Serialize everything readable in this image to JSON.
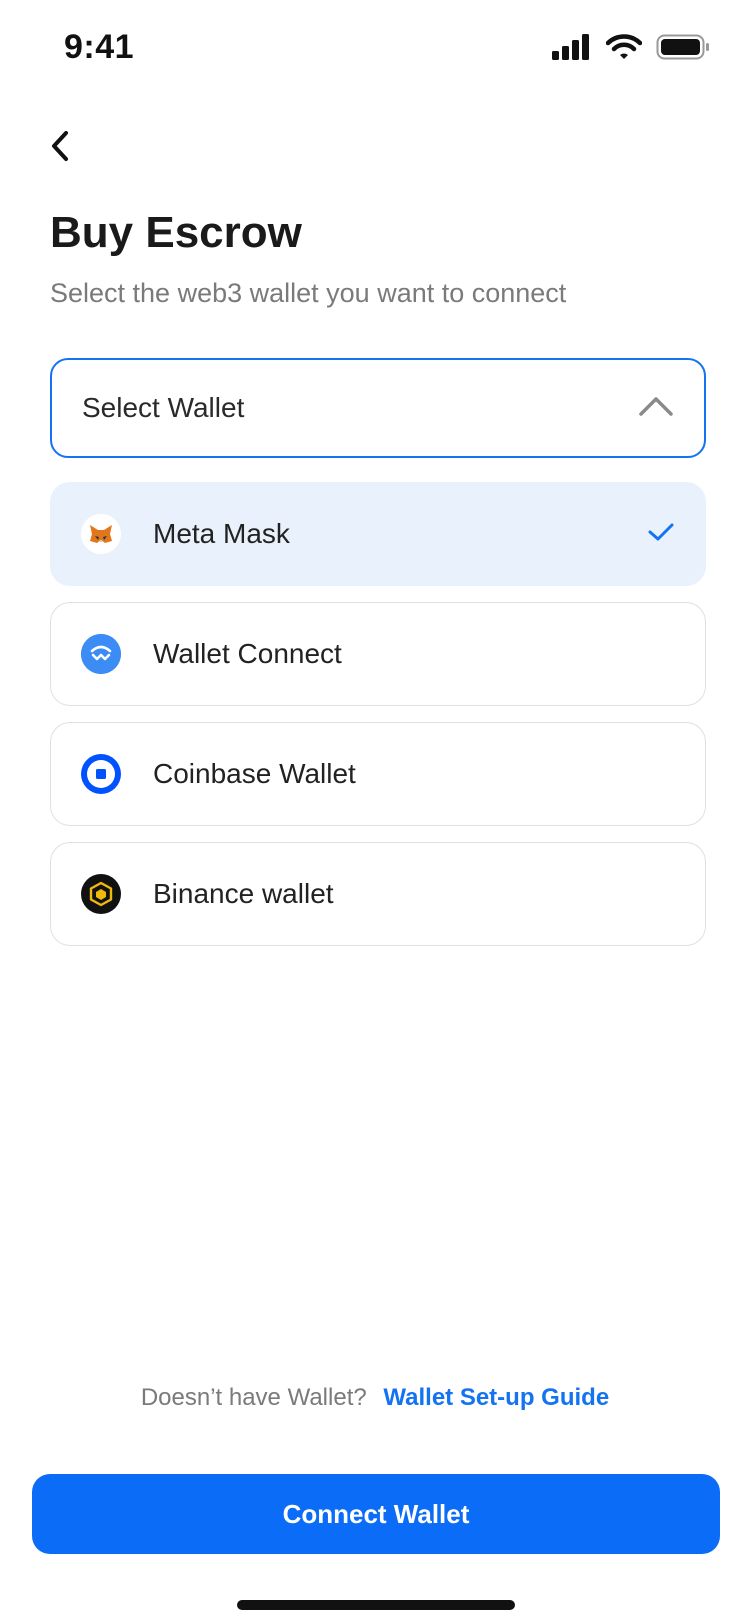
{
  "status_bar": {
    "time": "9:41",
    "icons": [
      "signal-icon",
      "wifi-icon",
      "battery-icon"
    ]
  },
  "header": {
    "back_icon": "chevron-left-icon",
    "title": "Buy Escrow",
    "subtitle": "Select the web3 wallet you want to connect"
  },
  "wallet_select": {
    "label": "Select Wallet",
    "icon": "chevron-up-icon"
  },
  "wallets": [
    {
      "label": "Meta Mask",
      "icon": "metamask-icon",
      "selected": true
    },
    {
      "label": "Wallet Connect",
      "icon": "walletconnect-icon",
      "selected": false
    },
    {
      "label": "Coinbase Wallet",
      "icon": "coinbase-icon",
      "selected": false
    },
    {
      "label": "Binance wallet",
      "icon": "binance-icon",
      "selected": false
    }
  ],
  "footer": {
    "prompt": "Doesn’t have Wallet?",
    "link": "Wallet Set-up Guide"
  },
  "cta": {
    "label": "Connect Wallet"
  },
  "colors": {
    "accent": "#0a6cf7",
    "selected_bg": "#e9f1fd",
    "muted_text": "#7a7a7a"
  }
}
